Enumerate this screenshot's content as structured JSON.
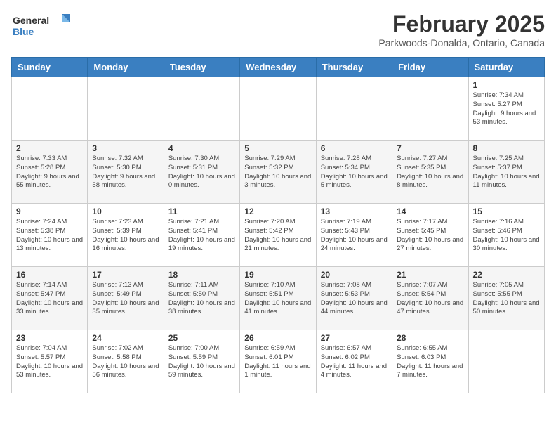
{
  "logo": {
    "general": "General",
    "blue": "Blue"
  },
  "title": "February 2025",
  "subtitle": "Parkwoods-Donalda, Ontario, Canada",
  "headers": [
    "Sunday",
    "Monday",
    "Tuesday",
    "Wednesday",
    "Thursday",
    "Friday",
    "Saturday"
  ],
  "weeks": [
    [
      {
        "day": "",
        "info": ""
      },
      {
        "day": "",
        "info": ""
      },
      {
        "day": "",
        "info": ""
      },
      {
        "day": "",
        "info": ""
      },
      {
        "day": "",
        "info": ""
      },
      {
        "day": "",
        "info": ""
      },
      {
        "day": "1",
        "info": "Sunrise: 7:34 AM\nSunset: 5:27 PM\nDaylight: 9 hours and 53 minutes."
      }
    ],
    [
      {
        "day": "2",
        "info": "Sunrise: 7:33 AM\nSunset: 5:28 PM\nDaylight: 9 hours and 55 minutes."
      },
      {
        "day": "3",
        "info": "Sunrise: 7:32 AM\nSunset: 5:30 PM\nDaylight: 9 hours and 58 minutes."
      },
      {
        "day": "4",
        "info": "Sunrise: 7:30 AM\nSunset: 5:31 PM\nDaylight: 10 hours and 0 minutes."
      },
      {
        "day": "5",
        "info": "Sunrise: 7:29 AM\nSunset: 5:32 PM\nDaylight: 10 hours and 3 minutes."
      },
      {
        "day": "6",
        "info": "Sunrise: 7:28 AM\nSunset: 5:34 PM\nDaylight: 10 hours and 5 minutes."
      },
      {
        "day": "7",
        "info": "Sunrise: 7:27 AM\nSunset: 5:35 PM\nDaylight: 10 hours and 8 minutes."
      },
      {
        "day": "8",
        "info": "Sunrise: 7:25 AM\nSunset: 5:37 PM\nDaylight: 10 hours and 11 minutes."
      }
    ],
    [
      {
        "day": "9",
        "info": "Sunrise: 7:24 AM\nSunset: 5:38 PM\nDaylight: 10 hours and 13 minutes."
      },
      {
        "day": "10",
        "info": "Sunrise: 7:23 AM\nSunset: 5:39 PM\nDaylight: 10 hours and 16 minutes."
      },
      {
        "day": "11",
        "info": "Sunrise: 7:21 AM\nSunset: 5:41 PM\nDaylight: 10 hours and 19 minutes."
      },
      {
        "day": "12",
        "info": "Sunrise: 7:20 AM\nSunset: 5:42 PM\nDaylight: 10 hours and 21 minutes."
      },
      {
        "day": "13",
        "info": "Sunrise: 7:19 AM\nSunset: 5:43 PM\nDaylight: 10 hours and 24 minutes."
      },
      {
        "day": "14",
        "info": "Sunrise: 7:17 AM\nSunset: 5:45 PM\nDaylight: 10 hours and 27 minutes."
      },
      {
        "day": "15",
        "info": "Sunrise: 7:16 AM\nSunset: 5:46 PM\nDaylight: 10 hours and 30 minutes."
      }
    ],
    [
      {
        "day": "16",
        "info": "Sunrise: 7:14 AM\nSunset: 5:47 PM\nDaylight: 10 hours and 33 minutes."
      },
      {
        "day": "17",
        "info": "Sunrise: 7:13 AM\nSunset: 5:49 PM\nDaylight: 10 hours and 35 minutes."
      },
      {
        "day": "18",
        "info": "Sunrise: 7:11 AM\nSunset: 5:50 PM\nDaylight: 10 hours and 38 minutes."
      },
      {
        "day": "19",
        "info": "Sunrise: 7:10 AM\nSunset: 5:51 PM\nDaylight: 10 hours and 41 minutes."
      },
      {
        "day": "20",
        "info": "Sunrise: 7:08 AM\nSunset: 5:53 PM\nDaylight: 10 hours and 44 minutes."
      },
      {
        "day": "21",
        "info": "Sunrise: 7:07 AM\nSunset: 5:54 PM\nDaylight: 10 hours and 47 minutes."
      },
      {
        "day": "22",
        "info": "Sunrise: 7:05 AM\nSunset: 5:55 PM\nDaylight: 10 hours and 50 minutes."
      }
    ],
    [
      {
        "day": "23",
        "info": "Sunrise: 7:04 AM\nSunset: 5:57 PM\nDaylight: 10 hours and 53 minutes."
      },
      {
        "day": "24",
        "info": "Sunrise: 7:02 AM\nSunset: 5:58 PM\nDaylight: 10 hours and 56 minutes."
      },
      {
        "day": "25",
        "info": "Sunrise: 7:00 AM\nSunset: 5:59 PM\nDaylight: 10 hours and 59 minutes."
      },
      {
        "day": "26",
        "info": "Sunrise: 6:59 AM\nSunset: 6:01 PM\nDaylight: 11 hours and 1 minute."
      },
      {
        "day": "27",
        "info": "Sunrise: 6:57 AM\nSunset: 6:02 PM\nDaylight: 11 hours and 4 minutes."
      },
      {
        "day": "28",
        "info": "Sunrise: 6:55 AM\nSunset: 6:03 PM\nDaylight: 11 hours and 7 minutes."
      },
      {
        "day": "",
        "info": ""
      }
    ]
  ]
}
